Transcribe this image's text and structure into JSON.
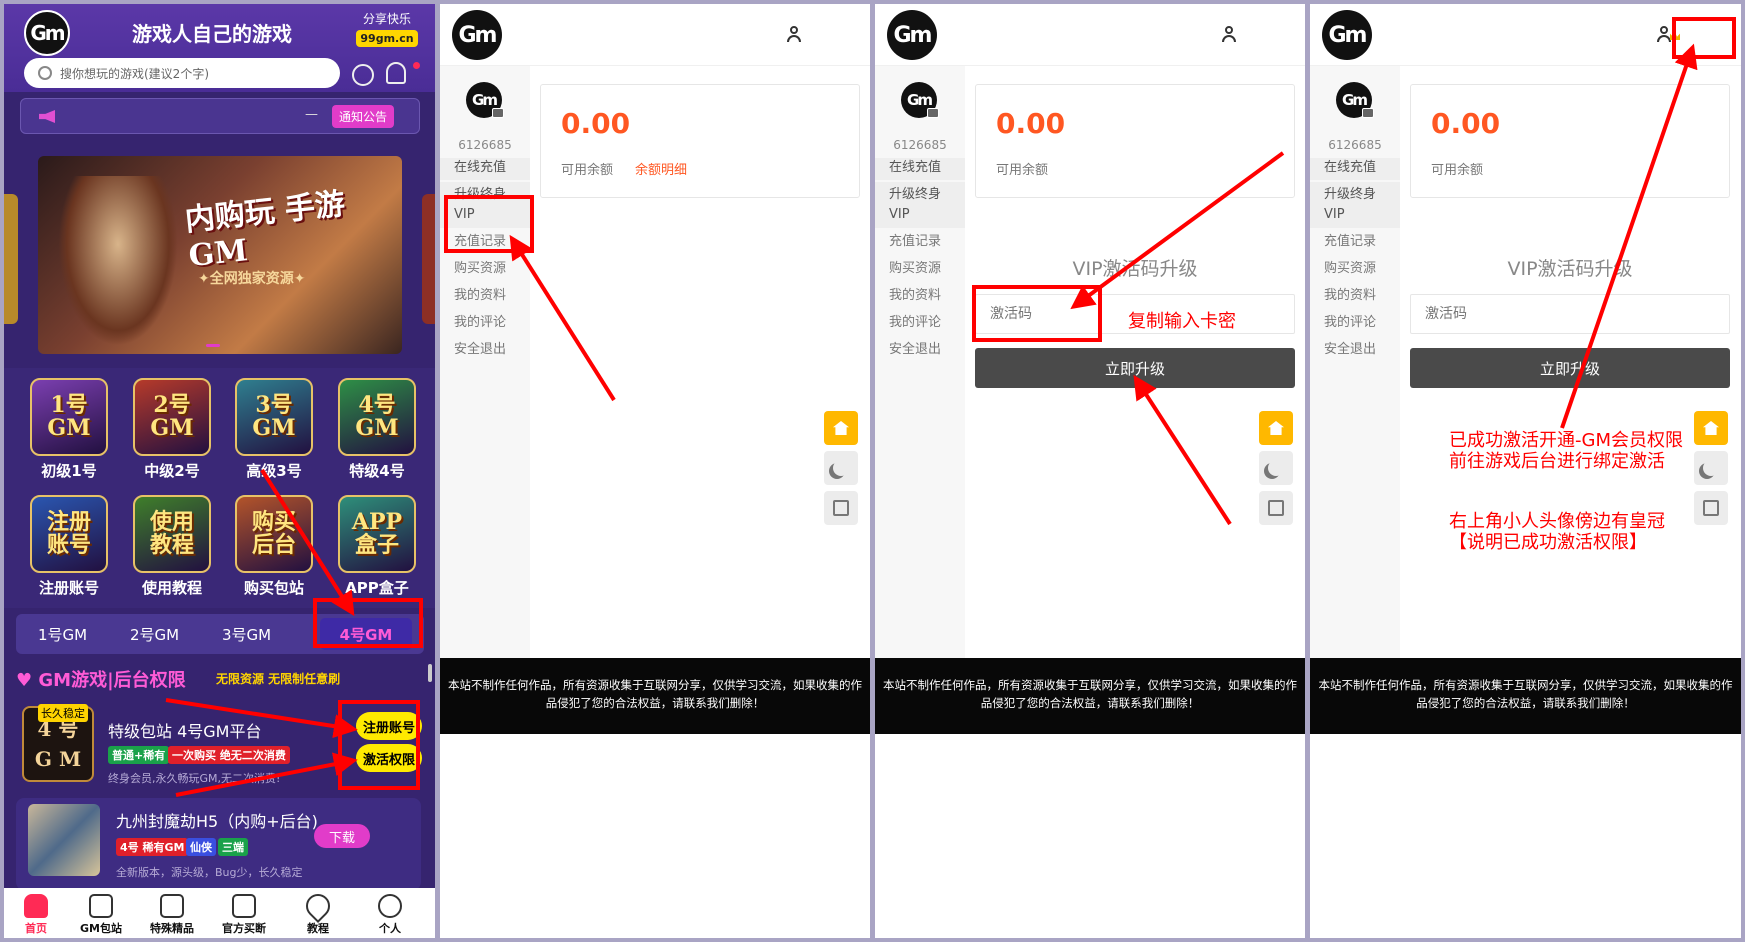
{
  "panel1": {
    "logo": "Gm",
    "slogan": "游戏人自己的游戏",
    "share_title": "分享快乐",
    "share_domain": "99gm.cn",
    "search_placeholder": "搜你想玩的游戏(建议2个字)",
    "notice_dash": "—",
    "notice_button": "通知公告",
    "banner_title": "内购玩 手游GM",
    "banner_subtitle": "✦全网独家资源✦",
    "tiles": [
      {
        "art": "1号\nGM",
        "label": "初级1号",
        "color": "#7b3fb0"
      },
      {
        "art": "2号\nGM",
        "label": "中级2号",
        "color": "#b63a2a"
      },
      {
        "art": "3号\nGM",
        "label": "高级3号",
        "color": "#2f7f8f"
      },
      {
        "art": "4号\nGM",
        "label": "特级4号",
        "color": "#2e8f46"
      },
      {
        "art": "注册\n账号",
        "label": "注册账号",
        "color": "#2a56b0"
      },
      {
        "art": "使用\n教程",
        "label": "使用教程",
        "color": "#3f7f2a"
      },
      {
        "art": "购买\n后台",
        "label": "购买包站",
        "color": "#b3542a"
      },
      {
        "art": "APP\n盒子",
        "label": "APP盒子",
        "color": "#2e8f7a"
      }
    ],
    "tabs": [
      "1号GM",
      "2号GM",
      "3号GM",
      "4号GM"
    ],
    "section_title": "GM游戏|后台权限",
    "section_sub": "无限资源 无限制任意刷",
    "card1": {
      "art": "4 号\nG M",
      "badge": "长久稳定",
      "title": "特级包站 4号GM平台",
      "tag1": "普通+稀有",
      "tag2": "一次购买 绝无二次消费",
      "desc": "终身会员,永久畅玩GM,无二次消费!",
      "button1": "注册账号",
      "button2": "激活权限"
    },
    "card2": {
      "title": "九州封魔劫H5（内购+后台)",
      "tag1": "4号 稀有GM",
      "tag2": "仙侠",
      "tag3": "三端",
      "desc": "全新版本，源头级，Bug少，长久稳定",
      "download": "下载"
    },
    "nav": [
      "首页",
      "GM包站",
      "特殊精品",
      "官方买断",
      "教程",
      "个人"
    ]
  },
  "user_panel": {
    "logo": "Gm",
    "user_id": "6126685",
    "side_items": [
      "在线充值",
      "升级终身\nVIP",
      "充值记录",
      "购买资源",
      "我的资料",
      "我的评论",
      "安全退出"
    ],
    "balance": "0.00",
    "balance_label": "可用余额",
    "balance_link": "余额明细",
    "vip_title": "VIP激活码升级",
    "code_placeholder": "激活码",
    "upgrade_button": "立即升级",
    "footer": "本站不制作任何作品，所有资源收集于互联网分享，仅供学习交流，如果收集的作品侵犯了您的合法权益，请联系我们删除！"
  },
  "annotations": {
    "copy_hint": "复制输入卡密",
    "success_1": "已成功激活开通-GM会员权限",
    "success_2": "前往游戏后台进行绑定激活",
    "crown_1": "右上角小人头像傍边有皇冠",
    "crown_2": "【说明已成功激活权限】"
  },
  "colors": {
    "panel1_bg": "#36246f",
    "accent_pink": "#e13cc9",
    "highlight_yellow": "#ffea00",
    "balance_orange": "#ff5722",
    "annotation_red": "#ff0000",
    "fab_yellow": "#ffb800"
  },
  "icons": [
    "search-icon",
    "chat-icon",
    "bell-icon",
    "speaker-icon",
    "user-icon",
    "crown-icon",
    "camera-icon",
    "home-icon",
    "moon-icon",
    "translate-icon"
  ]
}
